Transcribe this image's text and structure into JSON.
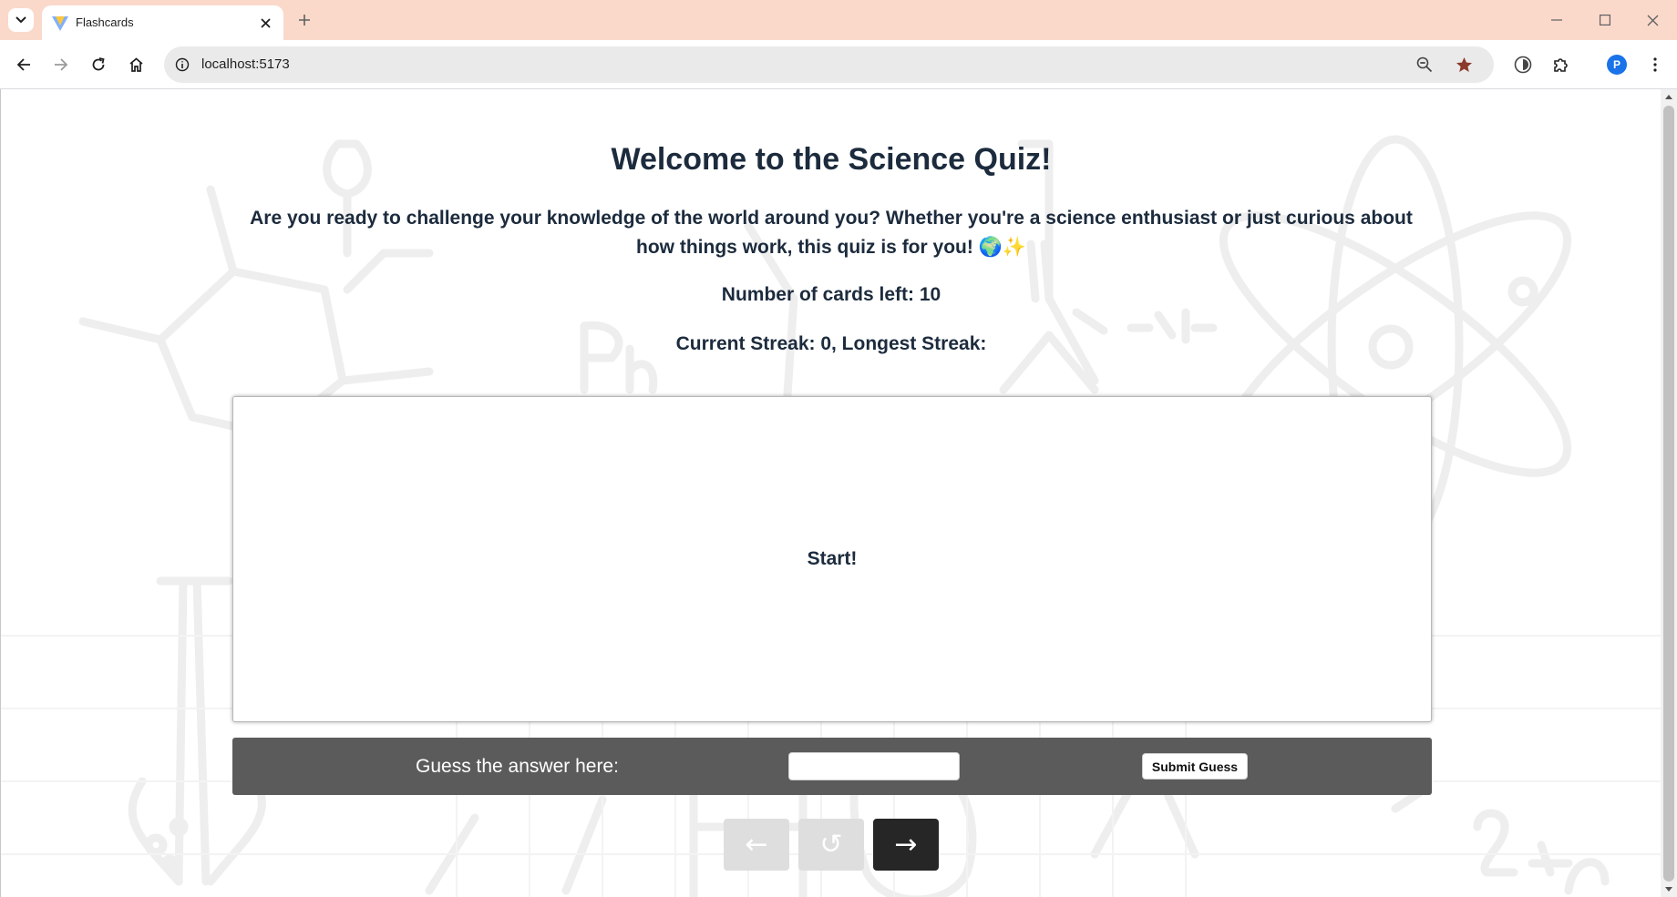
{
  "browser": {
    "tab_title": "Flashcards",
    "url": "localhost:5173",
    "profile_initial": "P"
  },
  "page": {
    "title": "Welcome to the Science Quiz!",
    "intro_line1": "Are you ready to challenge your knowledge of the world around you? Whether you're a science enthusiast or just curious about",
    "intro_line2": "how things work, this quiz is for you!",
    "intro_emoji": "🌍✨",
    "cards_left": "Number of cards left: 10",
    "streak": "Current Streak: 0, Longest Streak:",
    "card_text": "Start!"
  },
  "guess": {
    "label": "Guess the answer here:",
    "input_value": "",
    "submit_label": "Submit Guess"
  },
  "nav": {
    "prev_label": "←",
    "reset_label": "↺",
    "next_label": "→"
  },
  "colors": {
    "tabbar": "#fad9cb",
    "text": "#1c2b3d",
    "guess_bar": "#5b5b5b",
    "nav_disabled": "#dedede",
    "nav_active": "#262626",
    "profile": "#1a73e8"
  }
}
